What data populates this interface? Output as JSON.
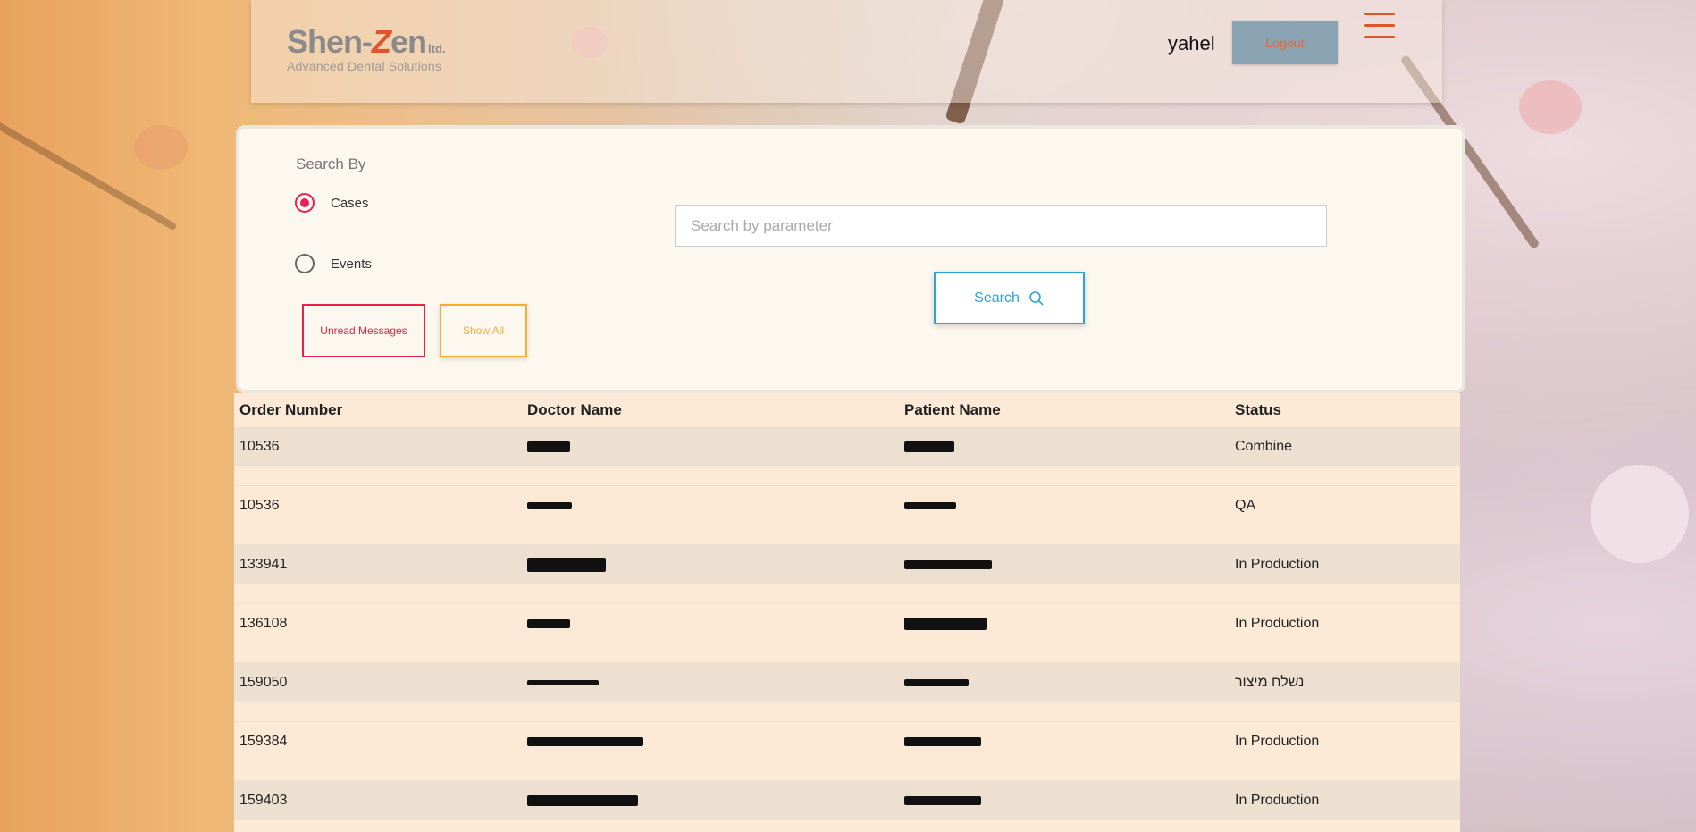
{
  "header": {
    "logo_main_left": "Shen-",
    "logo_main_z": "Z",
    "logo_main_right": "en",
    "logo_ltd": "ltd.",
    "logo_sub": "Advanced Dental Solutions",
    "user_name": "yahel",
    "logout_label": "Logout",
    "menu_icon": "hamburger-menu-icon"
  },
  "search": {
    "search_by_label": "Search By",
    "radio_cases_label": "Cases",
    "radio_events_label": "Events",
    "selected": "Cases",
    "unread_label": "Unread Messages",
    "show_all_label": "Show All",
    "input_placeholder": "Search by parameter",
    "input_value": "",
    "search_button_label": "Search",
    "search_icon": "magnifier-icon"
  },
  "table": {
    "headers": [
      "Order Number",
      "Doctor Name",
      "Patient Name",
      "Status"
    ],
    "rows": [
      {
        "order": "10536",
        "status": "Combine"
      },
      {
        "order": "10536",
        "status": "QA"
      },
      {
        "order": "133941",
        "status": "In Production"
      },
      {
        "order": "136108",
        "status": "In Production"
      },
      {
        "order": "159050",
        "status": "נשלח מיצור"
      },
      {
        "order": "159384",
        "status": "In Production"
      },
      {
        "order": "159403",
        "status": "In Production"
      }
    ]
  },
  "colors": {
    "accent_red": "#e8204a",
    "accent_orange": "#f6ae2d",
    "accent_blue": "#2aa4dd",
    "logout_bg": "#8aa3b3",
    "logo_orange": "#e0552a"
  }
}
